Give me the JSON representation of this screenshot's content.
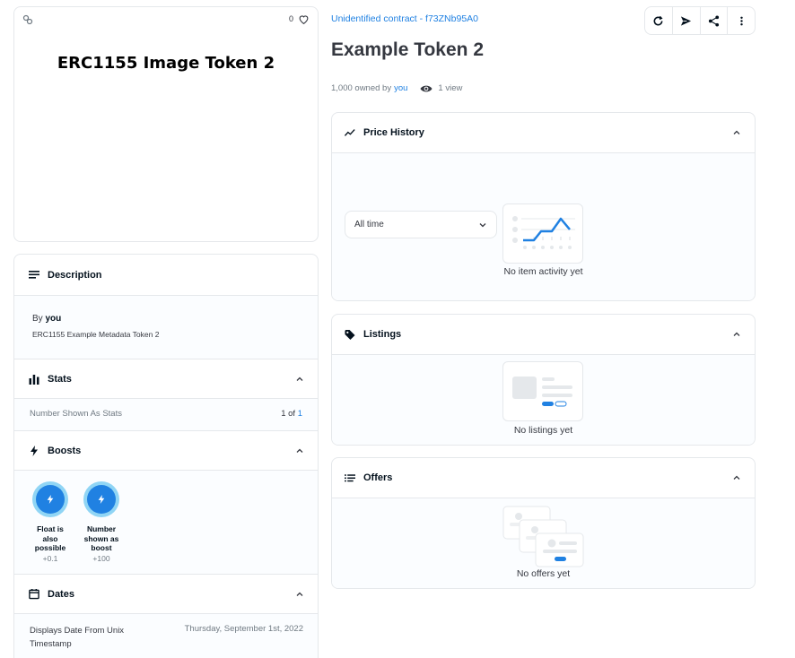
{
  "image_card": {
    "favorite_count": "0",
    "image_text": "ERC1155 Image Token 2"
  },
  "description": {
    "header": "Description",
    "by_prefix": "By",
    "by_user": "you",
    "text": "ERC1155 Example Metadata Token 2"
  },
  "stats": {
    "header": "Stats",
    "label": "Number Shown As Stats",
    "value_prefix": "1 of",
    "value_total": "1"
  },
  "boosts": {
    "header": "Boosts",
    "items": [
      {
        "label": "Float is also possible",
        "value": "+0.1"
      },
      {
        "label": "Number shown as boost",
        "value": "+100"
      }
    ]
  },
  "dates": {
    "header": "Dates",
    "label": "Displays Date From Unix Timestamp",
    "value": "Thursday, September 1st, 2022"
  },
  "asset": {
    "contract_link": "Unidentified contract - f73ZNb95A0",
    "title": "Example Token 2",
    "owned_prefix": "1,000 owned by",
    "owned_by": "you",
    "views": "1 view"
  },
  "price_history": {
    "header": "Price History",
    "filter_value": "All time",
    "empty_text": "No item activity yet"
  },
  "listings": {
    "header": "Listings",
    "empty_text": "No listings yet"
  },
  "offers": {
    "header": "Offers",
    "empty_text": "No offers yet"
  },
  "colors": {
    "accent": "#2081e2",
    "boost_ring": "#90d5f5",
    "border": "#e5e8eb",
    "text_dark": "#04111d",
    "text_muted": "#707a83"
  },
  "icons": [
    "link-icon",
    "heart-icon",
    "refresh-icon",
    "send-icon",
    "share-icon",
    "more-icon",
    "eye-icon",
    "description-icon",
    "stats-icon",
    "bolt-icon",
    "calendar-icon",
    "price-history-icon",
    "tag-icon",
    "offers-icon",
    "chevron-up-icon",
    "chevron-down-icon"
  ]
}
